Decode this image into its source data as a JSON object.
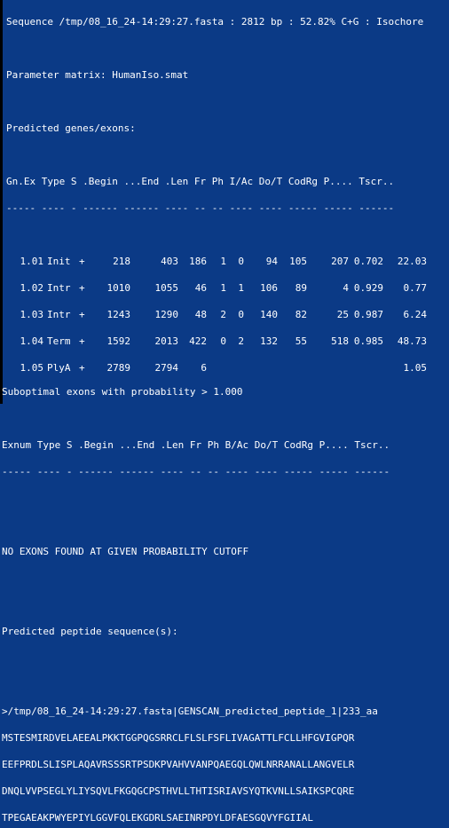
{
  "header": {
    "sequence_line": "Sequence /tmp/08_16_24-14:29:27.fasta : 2812 bp : 52.82% C+G : Isochore",
    "matrix_line": "Parameter matrix: HumanIso.smat",
    "predicted_title": "Predicted genes/exons:",
    "columns_line": "Gn.Ex Type S .Begin ...End .Len Fr Ph I/Ac Do/T CodRg P.... Tscr..",
    "dash_line": "----- ---- - ------ ------ ---- -- -- ---- ---- ----- ----- ------"
  },
  "exons": [
    {
      "gnex": "1.01",
      "type": "Init",
      "s": "+",
      "begin": "218",
      "end": "403",
      "len": "186",
      "fr": "1",
      "ph": "0",
      "iac": "94",
      "dot": "105",
      "codrg": "207",
      "p": "0.702",
      "tscr": "22.03"
    },
    {
      "gnex": "1.02",
      "type": "Intr",
      "s": "+",
      "begin": "1010",
      "end": "1055",
      "len": "46",
      "fr": "1",
      "ph": "1",
      "iac": "106",
      "dot": "89",
      "codrg": "4",
      "p": "0.929",
      "tscr": "0.77"
    },
    {
      "gnex": "1.03",
      "type": "Intr",
      "s": "+",
      "begin": "1243",
      "end": "1290",
      "len": "48",
      "fr": "2",
      "ph": "0",
      "iac": "140",
      "dot": "82",
      "codrg": "25",
      "p": "0.987",
      "tscr": "6.24"
    },
    {
      "gnex": "1.04",
      "type": "Term",
      "s": "+",
      "begin": "1592",
      "end": "2013",
      "len": "422",
      "fr": "0",
      "ph": "2",
      "iac": "132",
      "dot": "55",
      "codrg": "518",
      "p": "0.985",
      "tscr": "48.73"
    },
    {
      "gnex": "1.05",
      "type": "PlyA",
      "s": "+",
      "begin": "2789",
      "end": "2794",
      "len": "6",
      "fr": "",
      "ph": "",
      "iac": "",
      "dot": "",
      "codrg": "",
      "p": "",
      "tscr": "1.05"
    }
  ],
  "suboptimal": {
    "title": "Suboptimal exons with probability > 1.000",
    "columns_line": "Exnum Type S .Begin ...End .Len Fr Ph B/Ac Do/T CodRg P.... Tscr..",
    "dash_line": "----- ---- - ------ ------ ---- -- -- ---- ---- ----- ----- ------",
    "none_found": "NO EXONS FOUND AT GIVEN PROBABILITY CUTOFF"
  },
  "peptide": {
    "title": "Predicted peptide sequence(s):",
    "fasta_header": ">/tmp/08_16_24-14:29:27.fasta|GENSCAN_predicted_peptide_1|233_aa",
    "lines": [
      "MSTESMIRDVELAEEALPKKTGGPQGSRRCLFLSLFSFLIVAGATTLFCLLHFGVIGPQR",
      "EEFPRDLSLISPLAQAVRSSSRTPSDKPVAHVVANPQAEGQLQWLNRRANALLANGVELR",
      "DNQLVVPSEGLYLIYSQVLFKGQGCPSTHVLLTHTISRIAVSYQTKVNLLSAIKSPCQRE",
      "TPEGAEAKPWYEPIYLGGVFQLEKGDRLSAEINRPDYLDFAESGQVYFGIIAL"
    ]
  }
}
